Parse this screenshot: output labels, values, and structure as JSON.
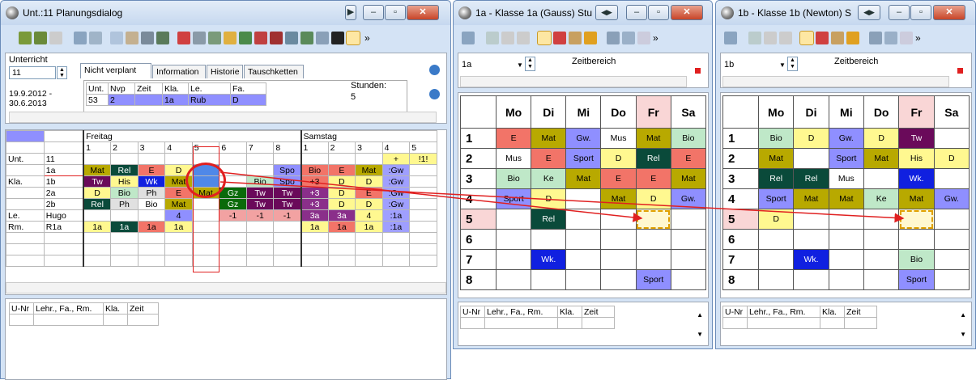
{
  "w1": {
    "title": "Unt.:11  Planungsdialog",
    "unterricht_label": "Unterricht",
    "unt_value": "11",
    "date_range": "19.9.2012 - 30.6.2013",
    "tabs": [
      "Nicht verplant",
      "Information",
      "Historie",
      "Tauschketten"
    ],
    "info_headers": [
      "Unt.",
      "Nvp",
      "Zeit",
      "Kla.",
      "Le.",
      "Fa."
    ],
    "info_values": [
      "53",
      "2",
      "",
      "1a",
      "Rub",
      "D"
    ],
    "stunden_label": "Stunden:",
    "stunden_value": "5",
    "days": [
      "Freitag",
      "Samstag"
    ],
    "hours": [
      "1",
      "2",
      "3",
      "4",
      "5",
      "6",
      "7",
      "8",
      "1",
      "2",
      "3",
      "4",
      "5"
    ],
    "rows": [
      {
        "h1": "Unt.",
        "h2": "11",
        "cells": [
          "",
          "",
          "",
          "",
          "",
          "",
          "",
          "",
          "",
          "",
          "",
          "+",
          "!1!"
        ],
        "bg": [
          "",
          "",
          "",
          "",
          "",
          "",
          "",
          "",
          "",
          "",
          "",
          "#fff890",
          "#fff890"
        ]
      },
      {
        "h1": "",
        "h2": "1a",
        "cells": [
          "Mat",
          "Rel",
          "E",
          "D",
          "",
          "",
          "",
          "Spo",
          "Bio",
          "E",
          "Mat",
          ":Gw",
          ""
        ],
        "bg": [
          "#b8a900",
          "#0a4a3a",
          "#f27468",
          "#fff890",
          "#4f88e8",
          "",
          "",
          "#8f8fff",
          "#f27468",
          "#f27468",
          "#b8a900",
          "#9f9fff",
          ""
        ]
      },
      {
        "h1": "Kla.",
        "h2": "1b",
        "cells": [
          "Tw",
          "His",
          "Wk",
          "Mat",
          "",
          "",
          "Bio",
          "Spo",
          "+3",
          "D",
          "D",
          ":Gw",
          ""
        ],
        "bg": [
          "#6a0a5a",
          "#fff890",
          "#1020e0",
          "#b8a900",
          "#4f88e8",
          "",
          "#bfe8c8",
          "#8f8fff",
          "#f27468",
          "#fff890",
          "#fff890",
          "#9f9fff",
          ""
        ]
      },
      {
        "h1": "",
        "h2": "2a",
        "cells": [
          "D",
          "Bio",
          "Ph",
          "E",
          "Mat",
          "Gz",
          "Tw",
          "Tw",
          "+3",
          "D",
          "E",
          ":Gw",
          ""
        ],
        "bg": [
          "#fff890",
          "#bfe8c8",
          "#e0e0e0",
          "#f27468",
          "#b8a900",
          "#0a6a0a",
          "#6a0a5a",
          "#6a0a5a",
          "#8a2f8a",
          "#fff890",
          "#f27468",
          "#9f9fff",
          ""
        ]
      },
      {
        "h1": "",
        "h2": "2b",
        "cells": [
          "Rel",
          "Ph",
          "Bio",
          "Mat",
          "",
          "Gz",
          "Tw",
          "Tw",
          "+3",
          "D",
          "D",
          ":Gw",
          ""
        ],
        "bg": [
          "#0a4a3a",
          "#e0e0e0",
          "#fff",
          "#b8a900",
          "",
          "#0a6a0a",
          "#6a0a5a",
          "#6a0a5a",
          "#8a2f8a",
          "#fff890",
          "#fff890",
          "#9f9fff",
          ""
        ]
      },
      {
        "h1": "Le.",
        "h2": "Hugo",
        "cells": [
          "",
          "",
          "",
          "4",
          "",
          "-1",
          "-1",
          "-1",
          "3a",
          "3a",
          "4",
          ":1a",
          ""
        ],
        "bg": [
          "",
          "",
          "",
          "#8f8fff",
          "",
          "#f2a2a2",
          "#f2a2a2",
          "#f2a2a2",
          "#8a2f8a",
          "#8a2f8a",
          "#fff890",
          "#9f9fff",
          ""
        ]
      },
      {
        "h1": "Rm.",
        "h2": "R1a",
        "cells": [
          "1a",
          "1a",
          "1a",
          "1a",
          "",
          "",
          "",
          "",
          "1a",
          "1a",
          "1a",
          ":1a",
          ""
        ],
        "bg": [
          "#fff890",
          "#0a4a3a",
          "#f27468",
          "#fff890",
          "",
          "",
          "",
          "",
          "#fff890",
          "#f27468",
          "#fff890",
          "#9f9fff",
          ""
        ]
      }
    ],
    "bottom_headers": [
      "U-Nr",
      "Lehr., Fa., Rm.",
      "Kla.",
      "Zeit"
    ]
  },
  "w2": {
    "title": "1a - Klasse 1a (Gauss)  Stu",
    "class_value": "1a",
    "zeitbereich": "Zeitbereich",
    "days": [
      "Mo",
      "Di",
      "Mi",
      "Do",
      "Fr",
      "Sa"
    ],
    "rows": [
      [
        "E",
        "Mat",
        "Gw.",
        "Mus",
        "Mat",
        "Bio"
      ],
      [
        "Mus",
        "E",
        "Sport",
        "D",
        "Rel",
        "E"
      ],
      [
        "Bio",
        "Ke",
        "Mat",
        "E",
        "E",
        "Mat"
      ],
      [
        "Sport",
        "D",
        "",
        "Mat",
        "D",
        "Gw."
      ],
      [
        "",
        "Rel",
        "",
        "",
        "",
        ""
      ],
      [
        "",
        "",
        "",
        "",
        "",
        ""
      ],
      [
        "",
        "Wk.",
        "",
        "",
        "",
        ""
      ],
      [
        "",
        "",
        "",
        "",
        "Sport",
        ""
      ]
    ],
    "bottom_headers": [
      "U-Nr",
      "Lehr., Fa., Rm.",
      "Kla.",
      "Zeit"
    ]
  },
  "w3": {
    "title": "1b - Klasse 1b (Newton)  S",
    "class_value": "1b",
    "zeitbereich": "Zeitbereich",
    "days": [
      "Mo",
      "Di",
      "Mi",
      "Do",
      "Fr",
      "Sa"
    ],
    "rows": [
      [
        "Bio",
        "D",
        "Gw.",
        "D",
        "Tw",
        ""
      ],
      [
        "Mat",
        "",
        "Sport",
        "Mat",
        "His",
        "D"
      ],
      [
        "Rel",
        "Rel",
        "Mus",
        "",
        "Wk.",
        ""
      ],
      [
        "Sport",
        "Mat",
        "Mat",
        "Ke",
        "Mat",
        "Gw."
      ],
      [
        "D",
        "",
        "",
        "",
        "",
        ""
      ],
      [
        "",
        "",
        "",
        "",
        "",
        ""
      ],
      [
        "",
        "Wk.",
        "",
        "",
        "Bio",
        ""
      ],
      [
        "",
        "",
        "",
        "",
        "Sport",
        ""
      ]
    ],
    "bottom_headers": [
      "U-Nr",
      "Lehr., Fa., Rm.",
      "Kla.",
      "Zeit"
    ]
  },
  "row_numbers": [
    "1",
    "2",
    "3",
    "4",
    "5",
    "6",
    "7",
    "8"
  ],
  "colors": {
    "mat": "#b8a900",
    "e": "#f27468",
    "gw": "#8f8fff",
    "rel": "#0a4a3a",
    "d": "#fff890",
    "bio": "#bfe8c8",
    "sport": "#8f8fff",
    "wk": "#1020e0",
    "tw": "#6a0a5a",
    "his": "#fff890",
    "ke": "#bfe8c8",
    "mus": "#fff",
    "accent_red": "#e02020"
  }
}
